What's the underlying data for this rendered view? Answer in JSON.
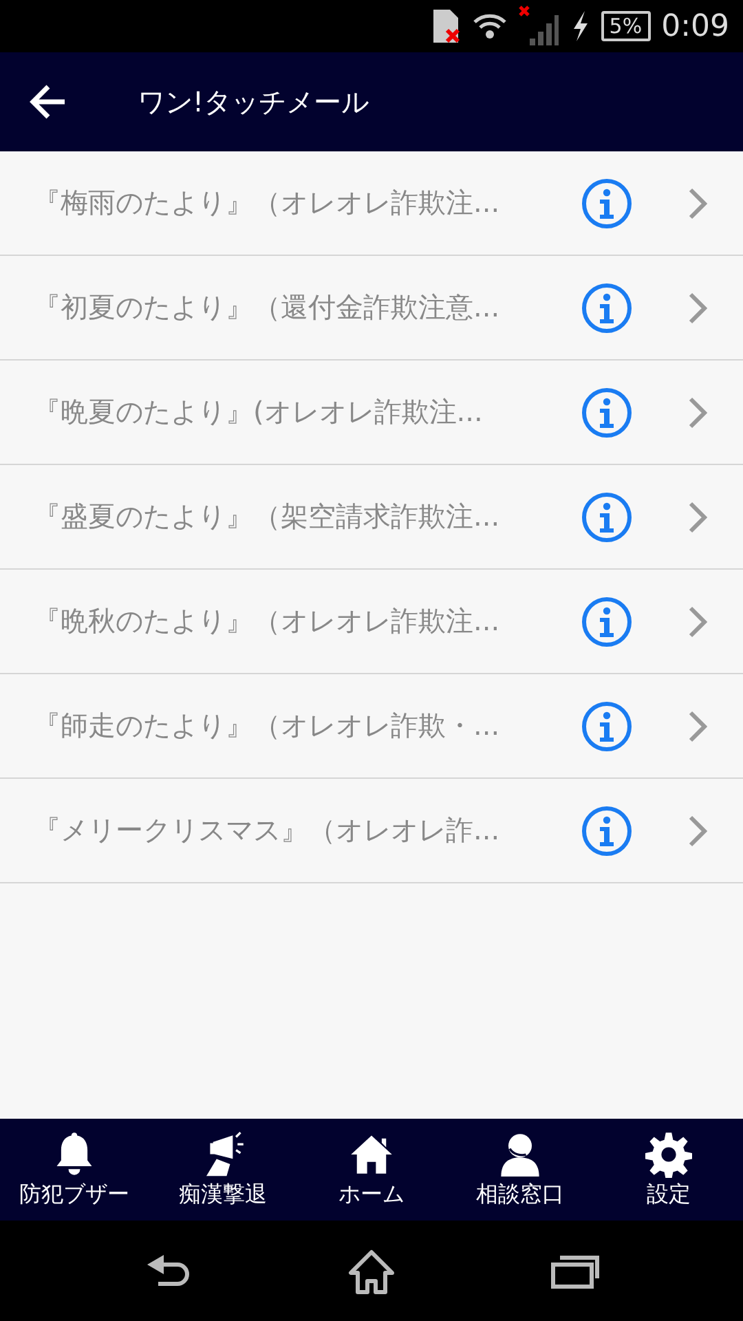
{
  "status_bar": {
    "battery": "5%",
    "time": "0:09"
  },
  "app_bar": {
    "title": "ワン!タッチメール"
  },
  "list": [
    {
      "title": "『梅雨のたより』（オレオレ詐欺注..."
    },
    {
      "title": "『初夏のたより』（還付金詐欺注意..."
    },
    {
      "title": "『晩夏のたより』(オレオレ詐欺注..."
    },
    {
      "title": "『盛夏のたより』（架空請求詐欺注..."
    },
    {
      "title": "『晩秋のたより』（オレオレ詐欺注..."
    },
    {
      "title": "『師走のたより』（オレオレ詐欺・..."
    },
    {
      "title": "『メリークリスマス』（オレオレ詐..."
    }
  ],
  "tab_bar": [
    {
      "kind": "bell",
      "label": "防犯ブザー"
    },
    {
      "kind": "megaphone",
      "label": "痴漢撃退"
    },
    {
      "kind": "home",
      "label": "ホーム"
    },
    {
      "kind": "person",
      "label": "相談窓口"
    },
    {
      "kind": "gear",
      "label": "設定"
    }
  ]
}
